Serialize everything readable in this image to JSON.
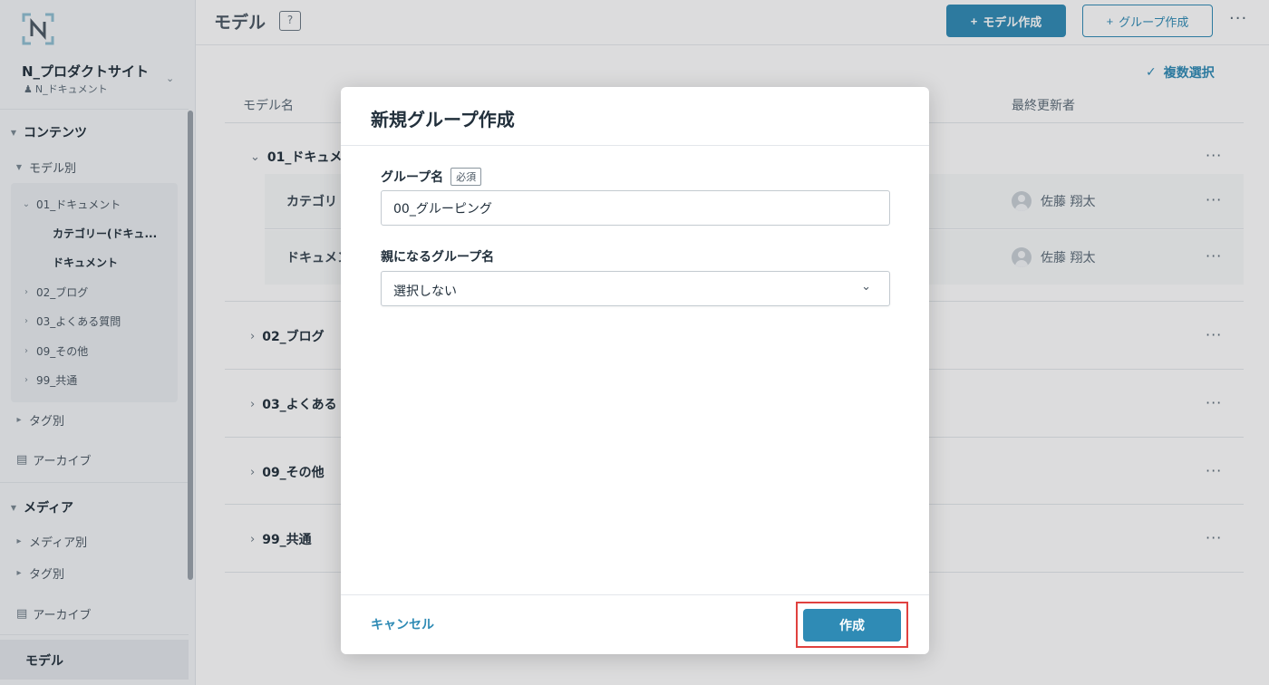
{
  "sidebar": {
    "site_name": "N_プロダクトサイト",
    "site_sub": "N_ドキュメント",
    "sections": {
      "contents": "コンテンツ",
      "by_model": "モデル別",
      "tree": [
        "01_ドキュメント",
        "カテゴリー(ドキュ...",
        "ドキュメント",
        "02_ブログ",
        "03_よくある質問",
        "09_その他",
        "99_共通"
      ],
      "by_tag": "タグ別",
      "archive": "アーカイブ",
      "media": "メディア",
      "by_media": "メディア別",
      "media_by_tag": "タグ別",
      "media_archive": "アーカイブ",
      "model": "モデル"
    }
  },
  "header": {
    "title": "モデル",
    "help_icon": "?",
    "create_model": "モデル作成",
    "create_group": "グループ作成",
    "multi_select": "複数選択"
  },
  "table": {
    "col_model_name": "モデル名",
    "col_last_updated_by": "最終更新者",
    "groups": [
      {
        "name": "01_ドキュメ",
        "expanded": true
      },
      {
        "name": "02_ブログ"
      },
      {
        "name": "03_よくある"
      },
      {
        "name": "09_その他"
      },
      {
        "name": "99_共通"
      }
    ],
    "models": [
      {
        "name": "カテゴリ",
        "user": "佐藤 翔太"
      },
      {
        "name": "ドキュメン",
        "user": "佐藤 翔太"
      }
    ]
  },
  "modal": {
    "title": "新規グループ作成",
    "group_name_label": "グループ名",
    "required_badge": "必須",
    "group_name_value": "00_グルーピング",
    "parent_label": "親になるグループ名",
    "parent_value": "選択しない",
    "cancel": "キャンセル",
    "create": "作成"
  },
  "colors": {
    "accent": "#2f8bb5",
    "highlight": "#e0413f"
  }
}
